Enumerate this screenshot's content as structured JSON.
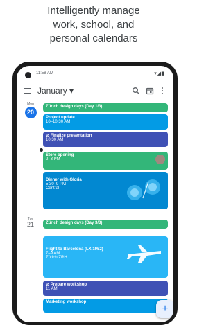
{
  "tagline": [
    "Intelligently manage",
    "work, school, and",
    "personal calendars"
  ],
  "status": {
    "time": "11:58 AM",
    "icons": "▾◢▮"
  },
  "toolbar": {
    "month_label": "January ▾"
  },
  "days": [
    {
      "dow": "Mon",
      "num": "20",
      "today": true
    },
    {
      "dow": "Tue",
      "num": "21",
      "today": false
    }
  ],
  "events": [
    {
      "title": "Zürich design days (Day 1/3)"
    },
    {
      "title": "Project update",
      "sub": "10–10:30 AM"
    },
    {
      "title": "⊘ Finalize presentation",
      "sub": "10:30 AM"
    },
    {
      "title": "Store opening",
      "sub": "2–3 PM"
    },
    {
      "title": "Dinner with Gloria",
      "sub": "5:30–9 PM",
      "sub2": "Central"
    },
    {
      "title": "Zürich design days (Day 3/3)"
    },
    {
      "title": "Flight to Barcelona (LX 1952)",
      "sub": "7–9 AM",
      "sub2": "Zürich ZRH"
    },
    {
      "title": "⊘ Prepare workshop",
      "sub": "11 AM"
    },
    {
      "title": "Marketing workshop"
    }
  ],
  "fab": {
    "label": "+"
  },
  "colors": {
    "green": "#33b679",
    "blue": "#039be5",
    "indigo": "#3f51b5",
    "accent": "#1a73e8"
  }
}
